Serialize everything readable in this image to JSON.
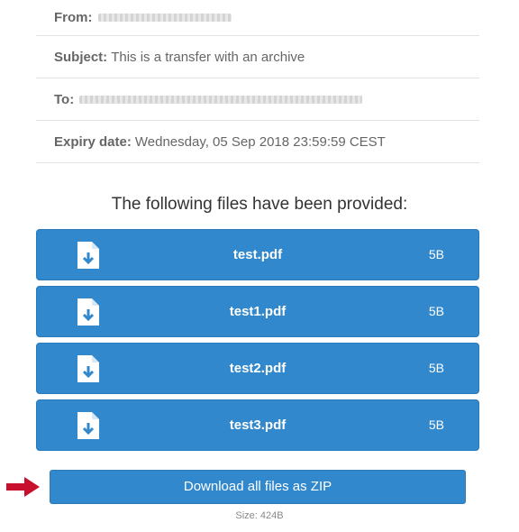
{
  "meta": {
    "from_label": "From:",
    "subject_label": "Subject:",
    "subject_value": "This is a transfer with an archive",
    "to_label": "To:",
    "expiry_label": "Expiry date:",
    "expiry_value": "Wednesday, 05 Sep 2018 23:59:59 CEST"
  },
  "files_heading": "The following files have been provided:",
  "files": [
    {
      "name": "test.pdf",
      "size": "5B",
      "icon": "file-download-icon"
    },
    {
      "name": "test1.pdf",
      "size": "5B",
      "icon": "file-download-icon"
    },
    {
      "name": "test2.pdf",
      "size": "5B",
      "icon": "file-download-icon"
    },
    {
      "name": "test3.pdf",
      "size": "5B",
      "icon": "file-download-icon"
    }
  ],
  "download_zip_label": "Download all files as ZIP",
  "zip_size": "Size: 424B",
  "colors": {
    "button": "#3188cc",
    "arrow": "#c8102e"
  }
}
